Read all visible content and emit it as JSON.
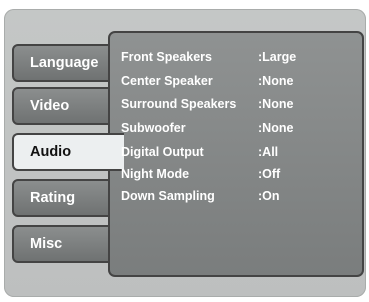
{
  "tabs": [
    {
      "label": "Language"
    },
    {
      "label": "Video"
    },
    {
      "label": "Audio"
    },
    {
      "label": "Rating"
    },
    {
      "label": "Misc"
    }
  ],
  "active_tab": "Audio",
  "settings": [
    {
      "label": "Front Speakers",
      "value": ":Large"
    },
    {
      "label": "Center Speaker",
      "value": ":None"
    },
    {
      "label": "Surround Speakers",
      "value": ":None"
    },
    {
      "label": "Subwoofer",
      "value": ":None"
    },
    {
      "label": "Digital Output",
      "value": ":All"
    },
    {
      "label": "Night  Mode",
      "value": ":Off"
    },
    {
      "label": "Down Sampling",
      "value": ":On"
    }
  ],
  "colors": {
    "frame": "#c4c7c6",
    "tab_inactive": "#7c7f7f",
    "tab_active": "#eceff0",
    "panel": "#858888",
    "text": "#ffffff"
  }
}
